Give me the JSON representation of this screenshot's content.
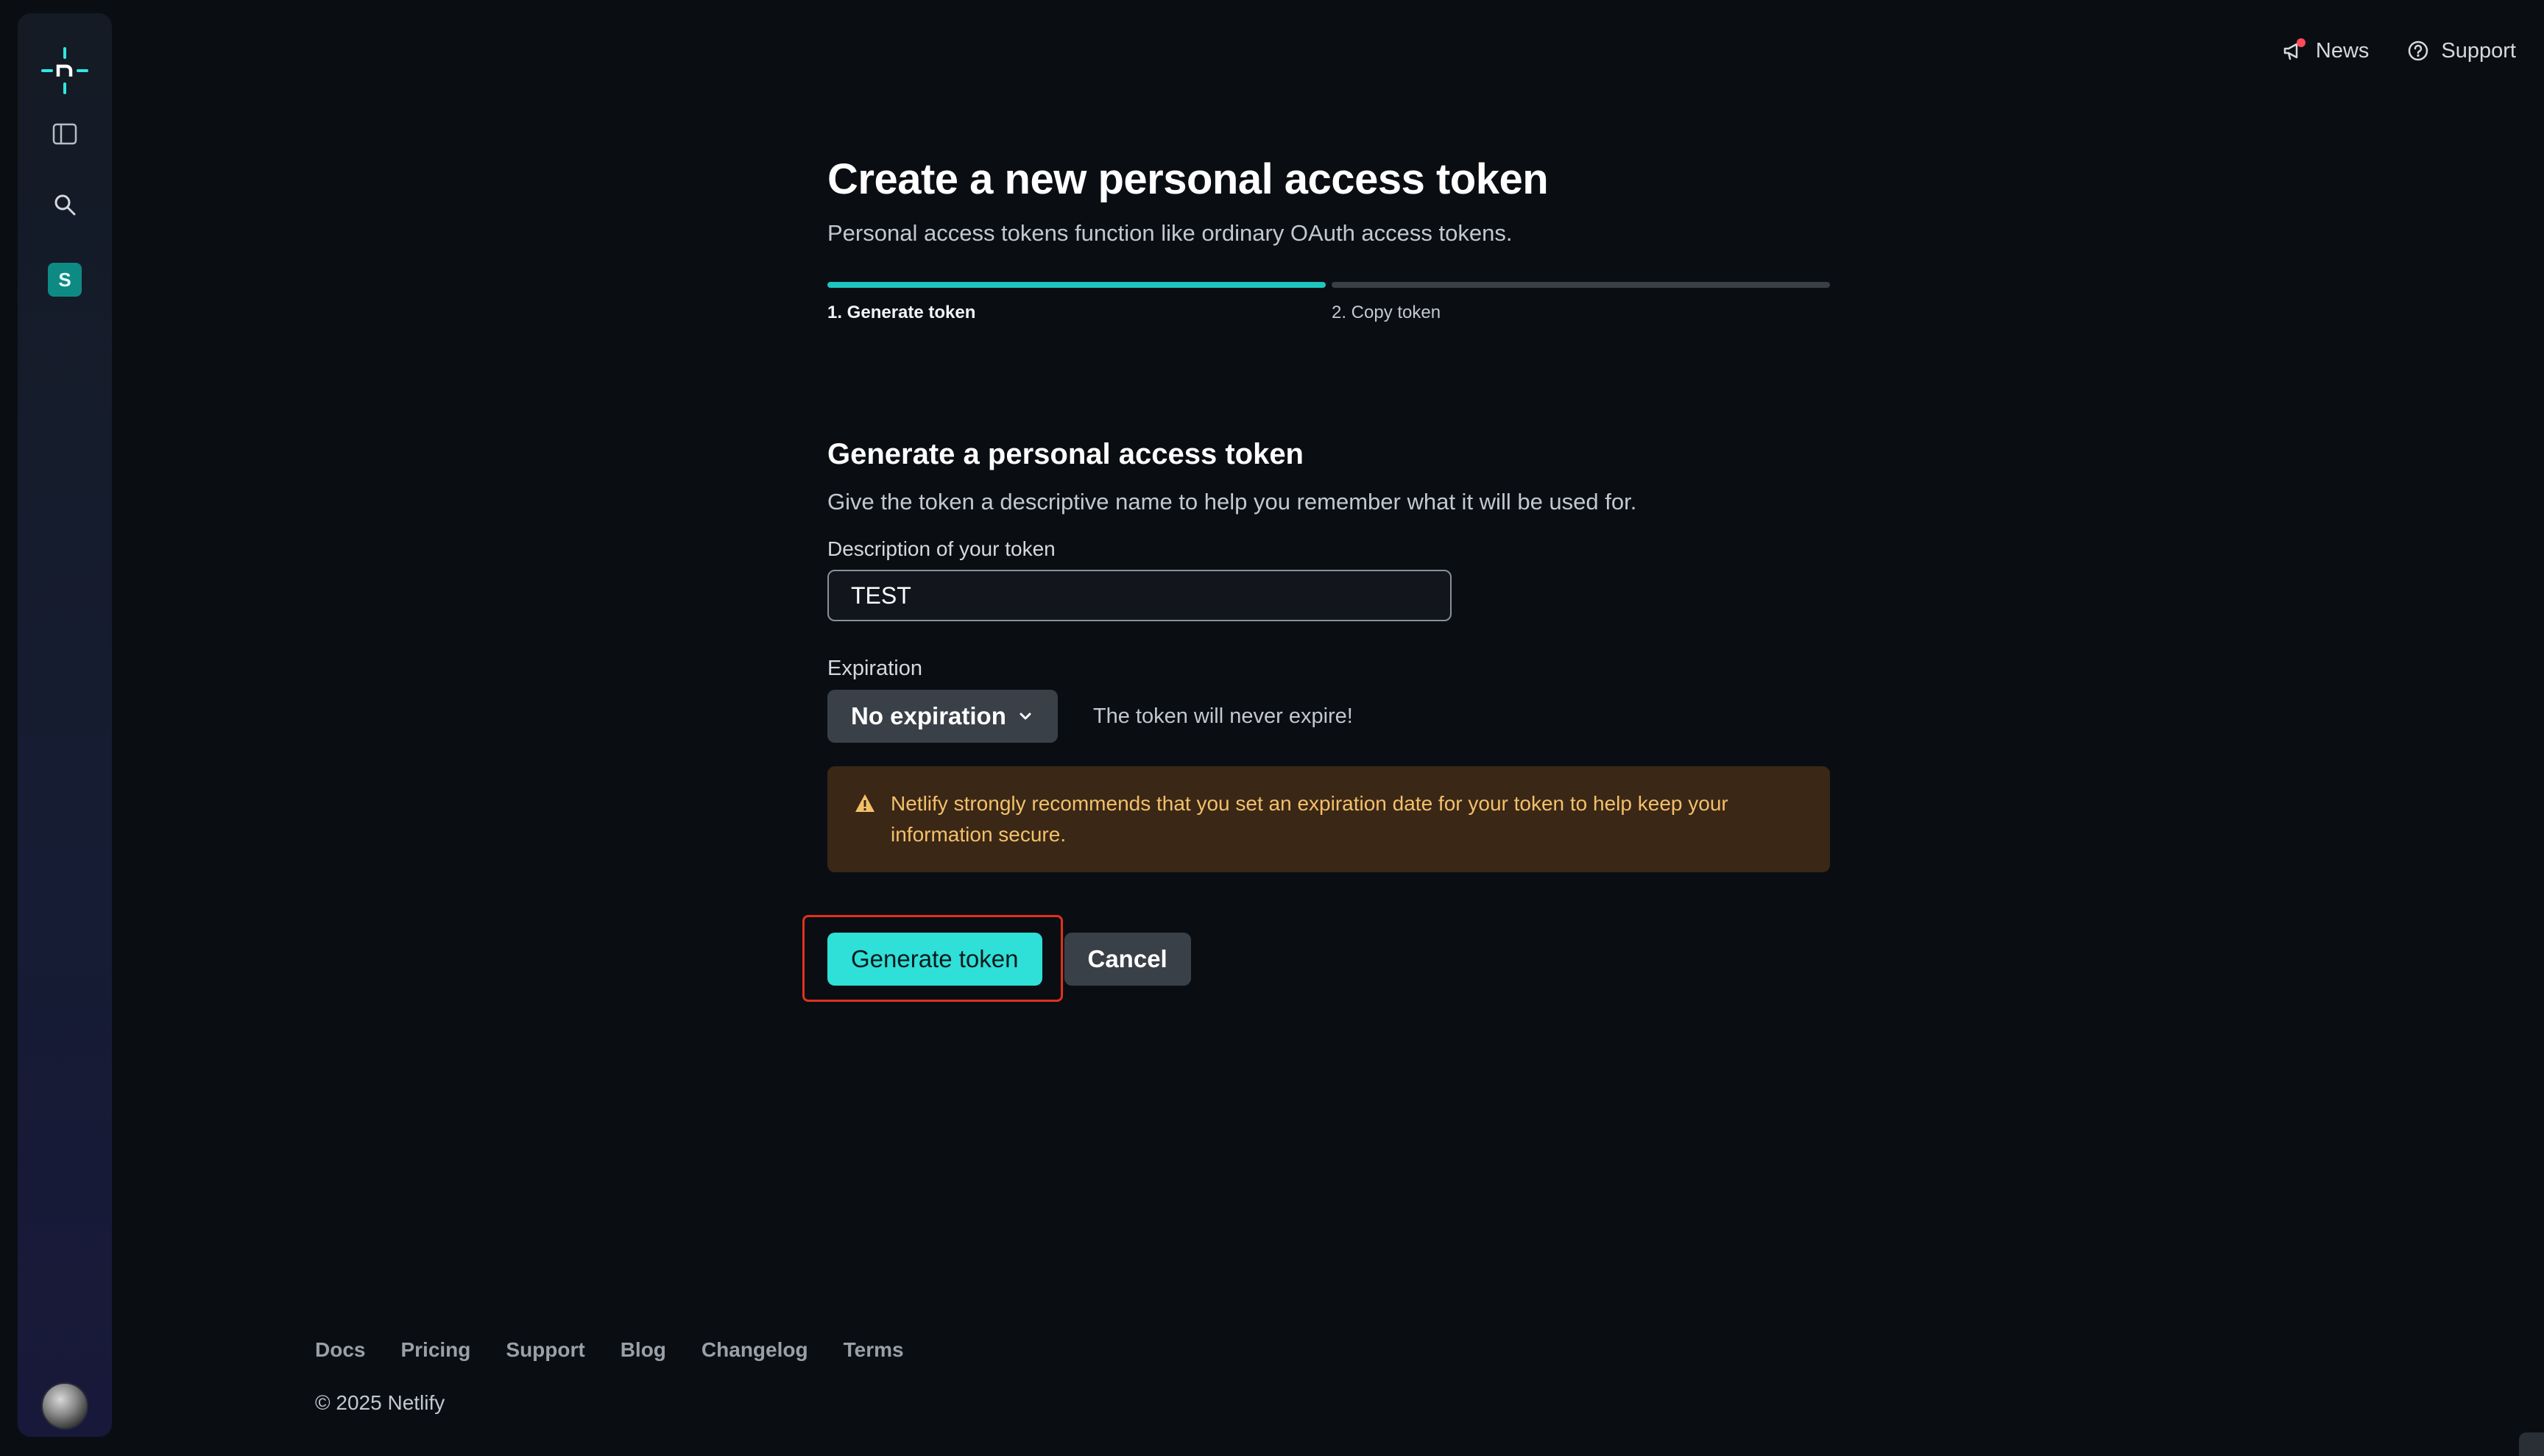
{
  "topbar": {
    "news_label": "News",
    "support_label": "Support"
  },
  "sidebar": {
    "team_initial": "S"
  },
  "page": {
    "title": "Create a new personal access token",
    "subtitle": "Personal access tokens function like ordinary OAuth access tokens.",
    "steps": [
      {
        "label": "1. Generate token",
        "active": true
      },
      {
        "label": "2. Copy token",
        "active": false
      }
    ]
  },
  "form": {
    "section_title": "Generate a personal access token",
    "section_subtitle": "Give the token a descriptive name to help you remember what it will be used for.",
    "description_label": "Description of your token",
    "description_value": "TEST",
    "expiration_label": "Expiration",
    "expiration_selected": "No expiration",
    "expiration_note": "The token will never expire!",
    "warning_text": "Netlify strongly recommends that you set an expiration date for your token to help keep your information secure.",
    "generate_label": "Generate token",
    "cancel_label": "Cancel"
  },
  "footer": {
    "links": [
      "Docs",
      "Pricing",
      "Support",
      "Blog",
      "Changelog",
      "Terms"
    ],
    "copyright": "© 2025 Netlify"
  },
  "colors": {
    "accent": "#2ee0d8",
    "warning_bg": "#3a2716",
    "warning_text": "#f3c06a",
    "highlight": "#e0321c"
  }
}
